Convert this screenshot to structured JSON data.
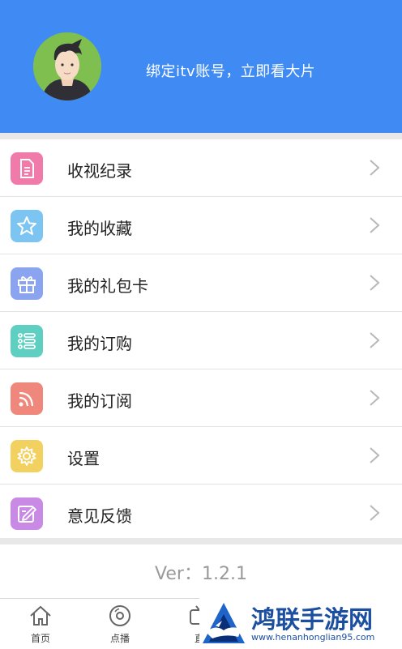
{
  "header": {
    "bind_text": "绑定itv账号，立即看大片",
    "bg_color": "#3f8bf3",
    "avatar_icon": "user-avatar-icon"
  },
  "menu": {
    "items": [
      {
        "label": "收视纪录",
        "icon": "document-icon",
        "color": "#f07aaa"
      },
      {
        "label": "我的收藏",
        "icon": "star-icon",
        "color": "#7cc4f2"
      },
      {
        "label": "我的礼包卡",
        "icon": "gift-icon",
        "color": "#8aa4ef"
      },
      {
        "label": "我的订购",
        "icon": "list-icon",
        "color": "#5fcfc1"
      },
      {
        "label": "我的订阅",
        "icon": "rss-icon",
        "color": "#f0877c"
      },
      {
        "label": "设置",
        "icon": "gear-icon",
        "color": "#f3d160"
      },
      {
        "label": "意见反馈",
        "icon": "edit-icon",
        "color": "#c98ae6"
      }
    ]
  },
  "version": "Ver：1.2.1",
  "tabbar": {
    "items": [
      {
        "label": "首页",
        "icon": "home-icon"
      },
      {
        "label": "点播",
        "icon": "disc-icon"
      },
      {
        "label": "直",
        "icon": "tv-icon"
      }
    ]
  },
  "watermark": {
    "title": "鸿联手游网",
    "url": "www.henanhonglian95.com"
  }
}
